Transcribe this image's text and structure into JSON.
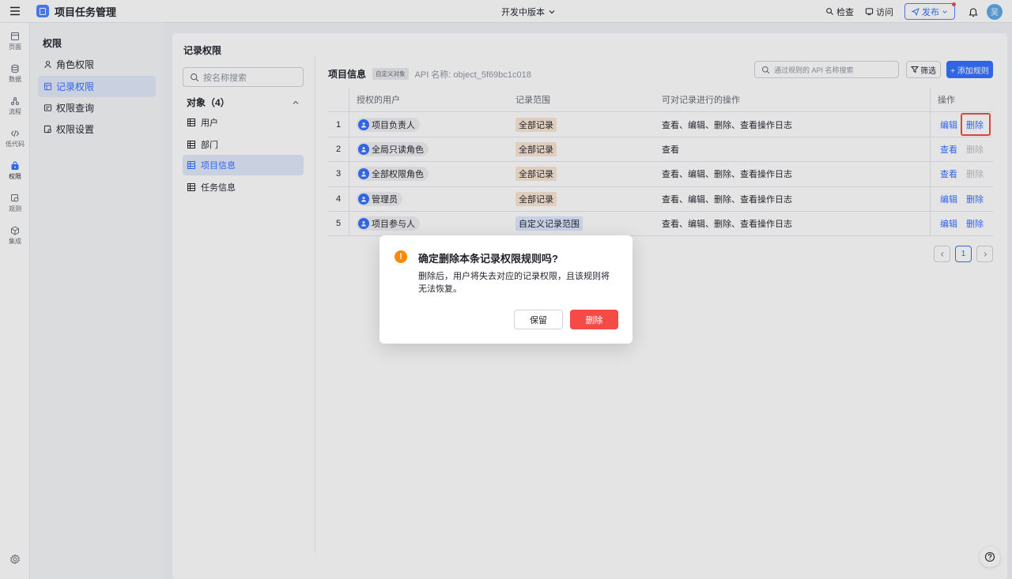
{
  "header": {
    "app_title": "项目任务管理",
    "version_label": "开发中版本",
    "check_label": "检查",
    "visit_label": "访问",
    "publish_label": "发布",
    "avatar_text": "吴"
  },
  "rail": {
    "items": [
      {
        "label": "页面",
        "icon": "page-icon"
      },
      {
        "label": "数据",
        "icon": "database-icon"
      },
      {
        "label": "流程",
        "icon": "flow-icon"
      },
      {
        "label": "低代码",
        "icon": "code-icon"
      },
      {
        "label": "权限",
        "icon": "lock-icon"
      },
      {
        "label": "观测",
        "icon": "observe-icon"
      },
      {
        "label": "集成",
        "icon": "integration-icon"
      }
    ]
  },
  "sidebar": {
    "title": "权限",
    "items": [
      {
        "label": "角色权限"
      },
      {
        "label": "记录权限"
      },
      {
        "label": "权限查询"
      },
      {
        "label": "权限设置"
      }
    ]
  },
  "main": {
    "title": "记录权限",
    "search_placeholder": "按名称搜索",
    "objects_header": "对象（4）",
    "objects": [
      {
        "label": "用户"
      },
      {
        "label": "部门"
      },
      {
        "label": "项目信息"
      },
      {
        "label": "任务信息"
      }
    ]
  },
  "detail": {
    "object_name": "项目信息",
    "object_tag": "自定义对象",
    "api_name": "API 名称: object_5f69bc1c018",
    "rule_search_placeholder": "通过规则的 API 名称搜索",
    "filter_label": "筛选",
    "add_rule_label": "+ 添加规则",
    "columns": [
      "授权的用户",
      "记录范围",
      "可对记录进行的操作",
      "操作"
    ],
    "rows": [
      {
        "no": "1",
        "user": "项目负责人",
        "scope": "全部记录",
        "ops": "查看、编辑、删除、查看操作日志",
        "action1": "编辑",
        "action2": "删除",
        "action1_disabled": false,
        "action2_disabled": false
      },
      {
        "no": "2",
        "user": "全局只读角色",
        "scope": "全部记录",
        "ops": "查看",
        "action1": "查看",
        "action2": "删除",
        "action1_disabled": false,
        "action2_disabled": true
      },
      {
        "no": "3",
        "user": "全部权限角色",
        "scope": "全部记录",
        "ops": "查看、编辑、删除、查看操作日志",
        "action1": "查看",
        "action2": "删除",
        "action1_disabled": false,
        "action2_disabled": true
      },
      {
        "no": "4",
        "user": "管理员",
        "scope": "全部记录",
        "ops": "查看、编辑、删除、查看操作日志",
        "action1": "编辑",
        "action2": "删除",
        "action1_disabled": false,
        "action2_disabled": false
      },
      {
        "no": "5",
        "user": "项目参与人",
        "scope": "自定义记录范围",
        "ops": "查看、编辑、删除、查看操作日志",
        "action1": "编辑",
        "action2": "删除",
        "action1_disabled": false,
        "action2_disabled": false
      }
    ],
    "pager_current": "1"
  },
  "dialog": {
    "icon": "!",
    "title": "确定删除本条记录权限规则吗?",
    "body": "删除后，用户将失去对应的记录权限，且该规则将无法恢复。",
    "keep_label": "保留",
    "delete_label": "删除"
  },
  "colors": {
    "accent": "#3370ff",
    "danger": "#f54a45",
    "warning": "#ff8800"
  }
}
